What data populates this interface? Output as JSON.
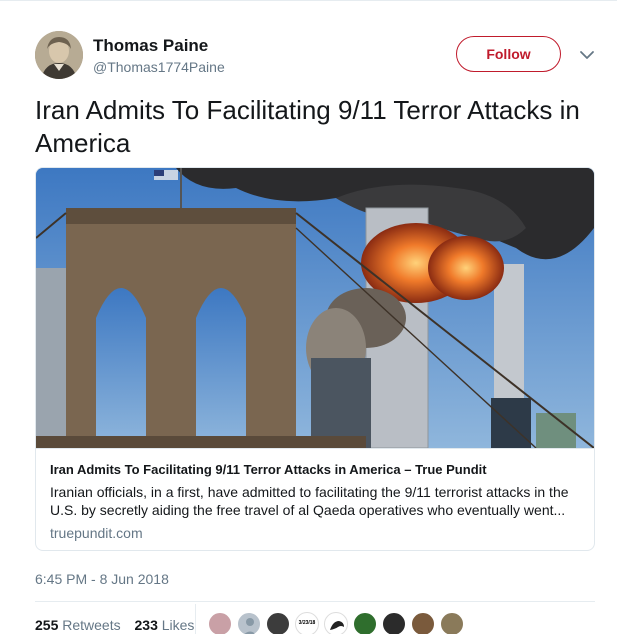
{
  "author": {
    "name": "Thomas Paine",
    "handle": "@Thomas1774Paine"
  },
  "follow_label": "Follow",
  "tweet_text": "Iran Admits To Facilitating 9/11 Terror Attacks in America",
  "card": {
    "title": "Iran Admits To Facilitating 9/11 Terror Attacks in America – True Pundit",
    "description": "Iranian officials, in a first, have admitted to facilitating the 9/11 terrorist attacks in the U.S. by secretly aiding the free travel of al Qaeda operatives who eventually went...",
    "domain": "truepundit.com"
  },
  "timestamp": "6:45 PM - 8 Jun 2018",
  "stats": {
    "retweets_count": "255",
    "retweets_label": "Retweets",
    "likes_count": "233",
    "likes_label": "Likes"
  },
  "liker_avatar_badge": "3/23/18",
  "colors": {
    "follow_accent": "#c01b2c",
    "text_primary": "#14171a",
    "text_secondary": "#657786",
    "border": "#e1e8ed"
  }
}
